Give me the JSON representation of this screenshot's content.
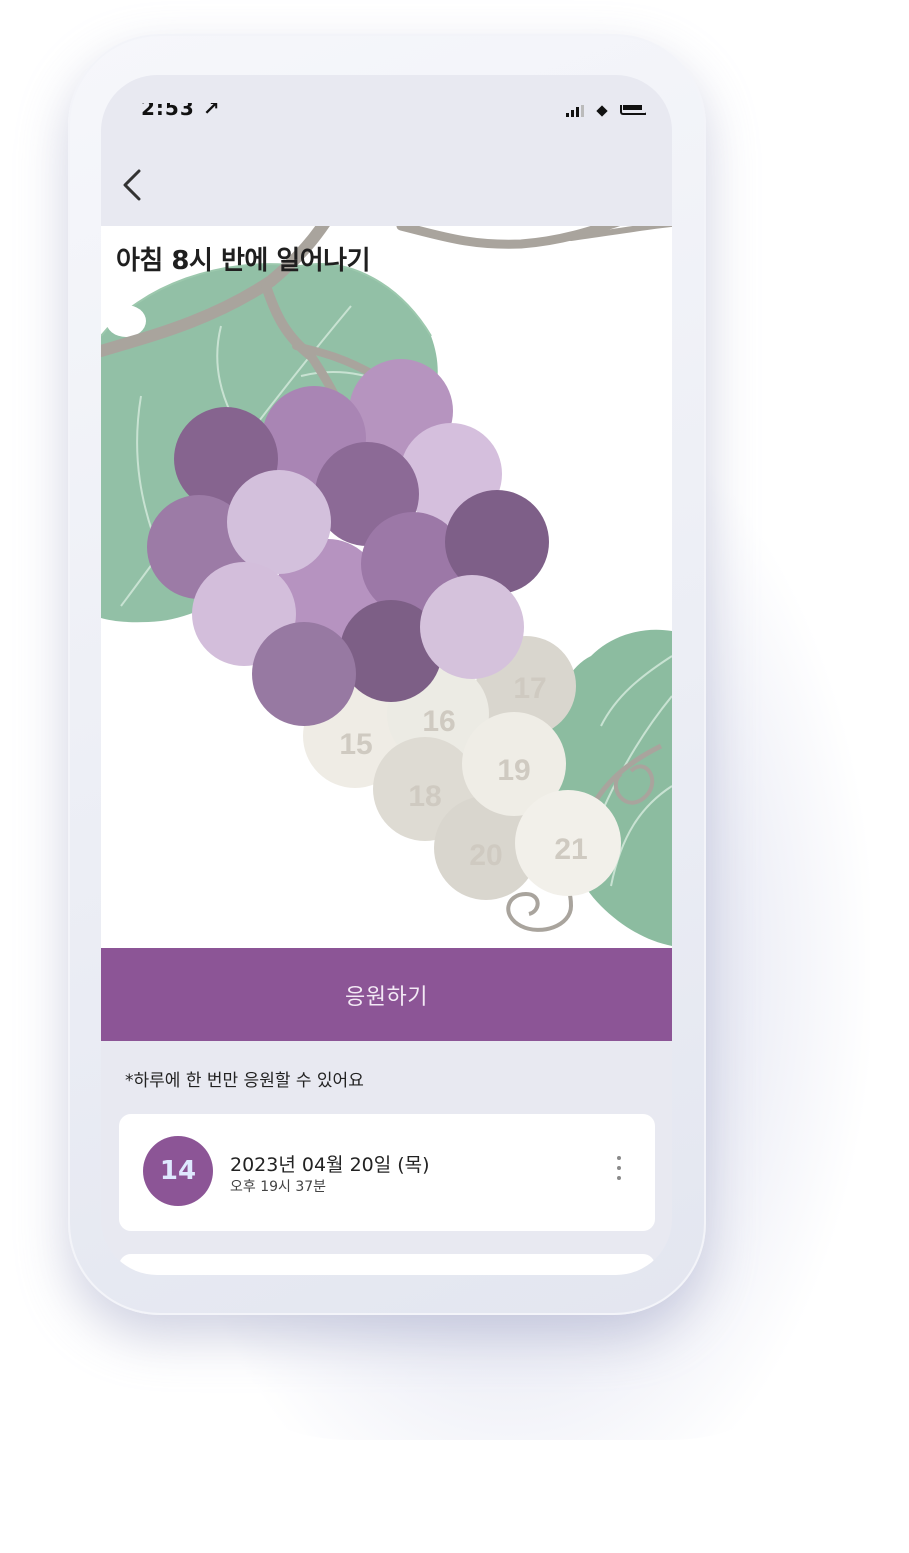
{
  "status_bar": {
    "time": "2:53 ↗"
  },
  "header": {
    "back_icon": "chevron-left-icon"
  },
  "challenge": {
    "title": "아침 8시 반에 일어나기",
    "remaining_grapes": [
      "15",
      "16",
      "17",
      "18",
      "19",
      "20",
      "21"
    ]
  },
  "actions": {
    "cheer_label": "응원하기",
    "notice": "*하루에 한 번만 응원할 수 있어요"
  },
  "records": [
    {
      "number": "14",
      "date": "2023년 04월 20일 (목)",
      "time": "오후 19시 37분",
      "menu_icon": "more-vertical-icon"
    }
  ],
  "colors": {
    "accent": "#8c5596",
    "screen_bg": "#e8e9f1",
    "grape_filled": "#9a7aa8",
    "grape_empty": "#e6e3dc",
    "leaf": "#7fb596"
  }
}
